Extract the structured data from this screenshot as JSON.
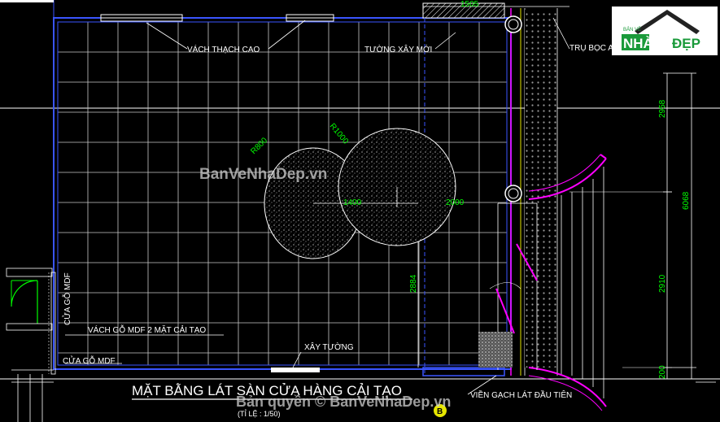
{
  "drawing": {
    "title": "MẶT BẰNG LÁT SÀN CỬA HÀNG CẢI TẠO",
    "scale_note": "(TỈ LỆ : 1/50)",
    "labels": {
      "gypsum_partition": "VÁCH THẠCH CAO",
      "new_wall": "TƯỜNG XÂY MỚI",
      "column_clad": "TRỤ BỌC AL",
      "mdf_partition": "VÁCH GỖ MDF 2 MẶT CẢI TẠO",
      "mdf_door_vertical": "CỬA GỖ MDF",
      "mdf_door": "CỬA GỖ MDF",
      "build_wall": "XÂY TƯỜNG",
      "first_tile_border": "VIỀN GẠCH LÁT ĐẦU TIÊN"
    },
    "dimensions": {
      "top": "1505",
      "right_upper": "2958",
      "right_total": "6068",
      "right_middle": "2910",
      "right_lower": "200",
      "vertical_left": "2884",
      "horizontal_1": "1400",
      "horizontal_2": "2000",
      "radius_1": "R800",
      "radius_2": "R1000"
    },
    "colors": {
      "background": "#000000",
      "grid": "#c8c8c8",
      "wall": "#3a55ff",
      "dimension": "#00ff00",
      "magenta": "#ff00ff",
      "yellow": "#e6e600"
    }
  },
  "logo": {
    "top_text": "BẢN VẼ",
    "brand_left": "NHÀ",
    "brand_right": "ĐẸP"
  },
  "watermarks": {
    "center": "BanVeNhaDep.vn",
    "bottom": "Bản quyền © BanVeNhaDep.vn"
  },
  "markers": {
    "section": "B"
  }
}
